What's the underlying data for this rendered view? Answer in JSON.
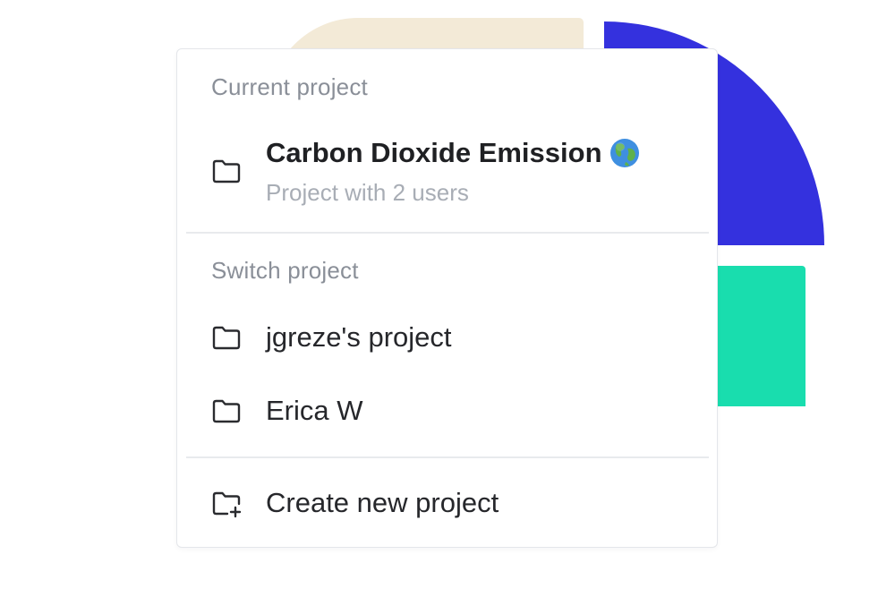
{
  "colors": {
    "accent_blue": "#3431de",
    "accent_green": "#19ddae",
    "accent_beige": "#f3ead7"
  },
  "dropdown": {
    "current_section_label": "Current project",
    "current_project": {
      "title": "Carbon Dioxide Emission",
      "title_icon": "globe-emoji",
      "subtitle": "Project with 2 users",
      "icon": "folder-icon"
    },
    "switch_section_label": "Switch project",
    "projects": [
      {
        "label": "jgreze's project",
        "icon": "folder-icon"
      },
      {
        "label": "Erica W",
        "icon": "folder-icon"
      }
    ],
    "create_project": {
      "label": "Create new project",
      "icon": "folder-plus-icon"
    }
  }
}
